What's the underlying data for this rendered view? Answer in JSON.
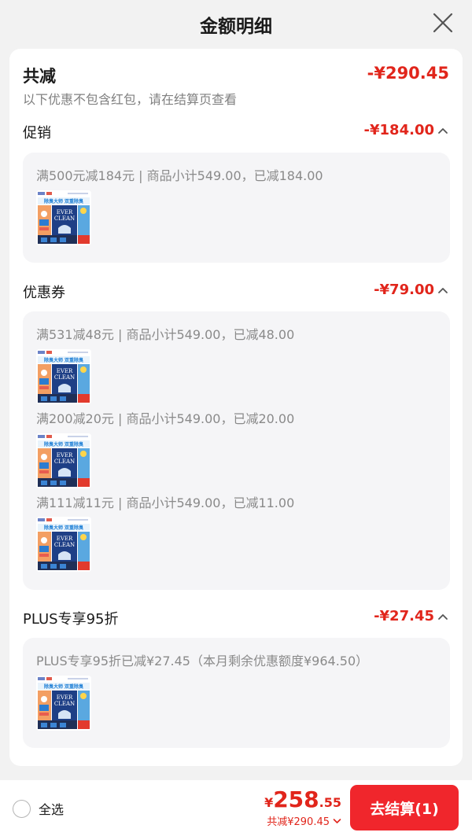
{
  "header": {
    "title": "金额明细",
    "close_icon": "close-icon"
  },
  "summary": {
    "label": "共减",
    "amount": "-¥290.45",
    "note": "以下优惠不包含红包，请在结算页查看"
  },
  "sections": [
    {
      "label": "促销",
      "amount": "-¥184.00",
      "expand_icon": "chevron-up-icon",
      "items": [
        {
          "text": "满500元减184元 | 商品小计549.00，已减184.00"
        }
      ]
    },
    {
      "label": "优惠券",
      "amount": "-¥79.00",
      "expand_icon": "chevron-up-icon",
      "items": [
        {
          "text": "满531减48元 | 商品小计549.00，已减48.00"
        },
        {
          "text": "满200减20元 | 商品小计549.00，已减20.00"
        },
        {
          "text": "满111减11元 | 商品小计549.00，已减11.00"
        }
      ]
    },
    {
      "label": "PLUS专享95折",
      "amount": "-¥27.45",
      "expand_icon": "chevron-up-icon",
      "items": [
        {
          "text": "PLUS专享95折已减¥27.45（本月剩余优惠额度¥964.50）"
        }
      ]
    }
  ],
  "product_thumb": {
    "brand_text": "EVER CLEAN",
    "banner_text": "除臭大师 双重除臭"
  },
  "footer": {
    "select_all_label": "全选",
    "currency": "¥",
    "price_integer": "258",
    "price_decimal": ".55",
    "total_discount": "共减¥290.45",
    "checkout_label": "去结算(1)"
  },
  "colors": {
    "accent": "#e1251b",
    "button": "#f0262c",
    "page_bg": "#f2f2f2",
    "detail_bg": "#f5f5f7"
  }
}
